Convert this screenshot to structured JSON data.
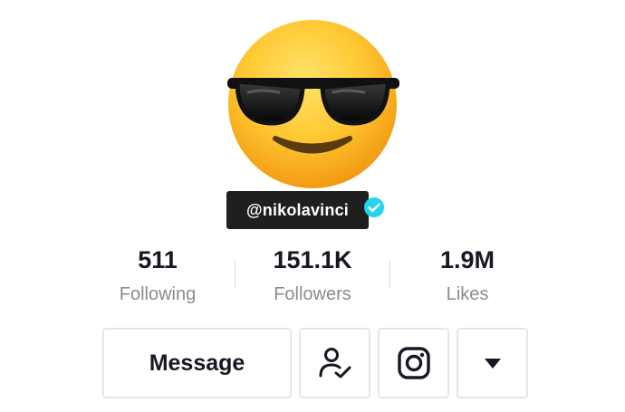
{
  "profile": {
    "avatar_icon": "sunglasses-emoji-icon",
    "username": "@nikolavinci",
    "verified_icon": "verified-check-icon",
    "verified_color": "#20d5ec"
  },
  "stats": [
    {
      "value": "511",
      "label": "Following"
    },
    {
      "value": "151.1K",
      "label": "Followers"
    },
    {
      "value": "1.9M",
      "label": "Likes"
    }
  ],
  "actions": {
    "message_label": "Message",
    "follow_icon": "user-check-icon",
    "instagram_icon": "instagram-icon",
    "more_icon": "caret-down-icon"
  }
}
